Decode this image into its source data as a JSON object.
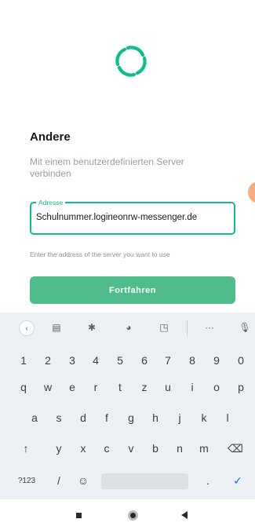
{
  "header": {
    "title": "Andere",
    "subtitle": "Mit einem benutzerdefinierten Server verbinden"
  },
  "server_field": {
    "label": "Adresse",
    "value": "Schulnummer.logineonrw-messenger.de",
    "helper": "Enter the address of the server you want to use"
  },
  "continue_button": {
    "label": "Fortfahren"
  },
  "colors": {
    "accent": "#0dbd8b",
    "button": "#4ebd8b",
    "keyboard_bg": "#eceff3"
  },
  "keyboard": {
    "toolbar_icons": [
      "back-chevron-icon",
      "clipboard-icon",
      "settings-icon",
      "palette-icon",
      "resize-icon",
      "more-icon",
      "microphone-icon"
    ],
    "toolbar_glyphs": {
      "back": "‹",
      "clipboard": "▤",
      "settings": "✱",
      "palette": "◕",
      "resize": "◳",
      "more": "···",
      "mic": "🎙"
    },
    "row1": [
      "1",
      "2",
      "3",
      "4",
      "5",
      "6",
      "7",
      "8",
      "9",
      "0"
    ],
    "row2": [
      "q",
      "w",
      "e",
      "r",
      "t",
      "z",
      "u",
      "i",
      "o",
      "p"
    ],
    "row3": [
      "a",
      "s",
      "d",
      "f",
      "g",
      "h",
      "j",
      "k",
      "l"
    ],
    "row4": [
      "↑",
      "y",
      "x",
      "c",
      "v",
      "b",
      "n",
      "m",
      "⌫"
    ],
    "row5": {
      "symbols": "?123",
      "slash": "/",
      "emoji": "☺",
      "period": ".",
      "enter": "✓"
    }
  }
}
